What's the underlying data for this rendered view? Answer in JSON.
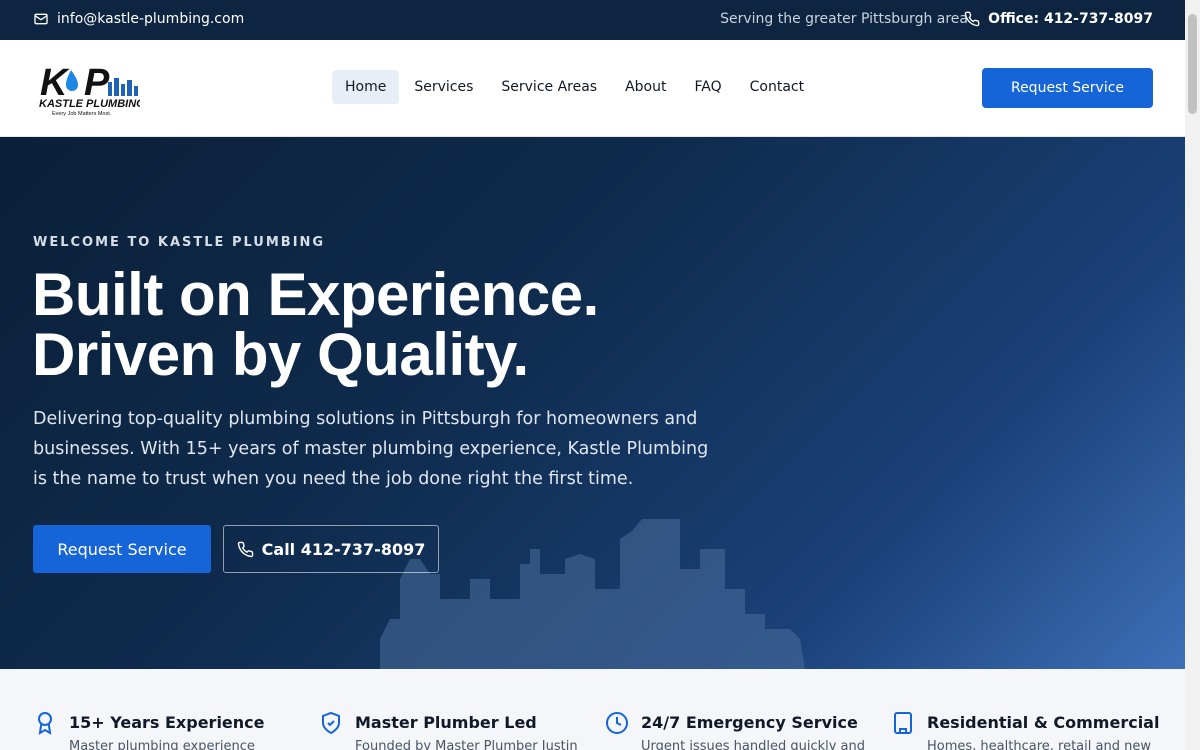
{
  "topbar": {
    "email": "info@kastle-plumbing.com",
    "service_area": "Serving the greater Pittsburgh area",
    "office": "Office: 412-737-8097"
  },
  "header": {
    "logo": {
      "brand": "KASTLE PLUMBING",
      "tagline": "Every Job Matters Most."
    },
    "nav": [
      {
        "label": "Home",
        "active": true
      },
      {
        "label": "Services"
      },
      {
        "label": "Service Areas"
      },
      {
        "label": "About"
      },
      {
        "label": "FAQ"
      },
      {
        "label": "Contact"
      }
    ],
    "cta": "Request Service"
  },
  "hero": {
    "eyebrow": "WELCOME TO KASTLE PLUMBING",
    "headline_1": "Built on Experience.",
    "headline_2": "Driven by Quality.",
    "lead": "Delivering top-quality plumbing solutions in Pittsburgh for homeowners and businesses. With 15+ years of master plumbing experience, Kastle Plumbing is the name to trust when you need the job done right the first time.",
    "primary_button": "Request Service",
    "call_button": "Call 412-737-8097"
  },
  "features": [
    {
      "icon": "award-icon",
      "title": "15+ Years Experience",
      "desc": "Master plumbing experience"
    },
    {
      "icon": "shield-check-icon",
      "title": "Master Plumber Led",
      "desc": "Founded by Master Plumber Justin"
    },
    {
      "icon": "clock-icon",
      "title": "24/7 Emergency Service",
      "desc": "Urgent issues handled quickly and"
    },
    {
      "icon": "building-icon",
      "title": "Residential & Commercial",
      "desc": "Homes, healthcare, retail and new"
    }
  ],
  "colors": {
    "navy": "#0d2540",
    "accent_blue": "#1565d8"
  }
}
